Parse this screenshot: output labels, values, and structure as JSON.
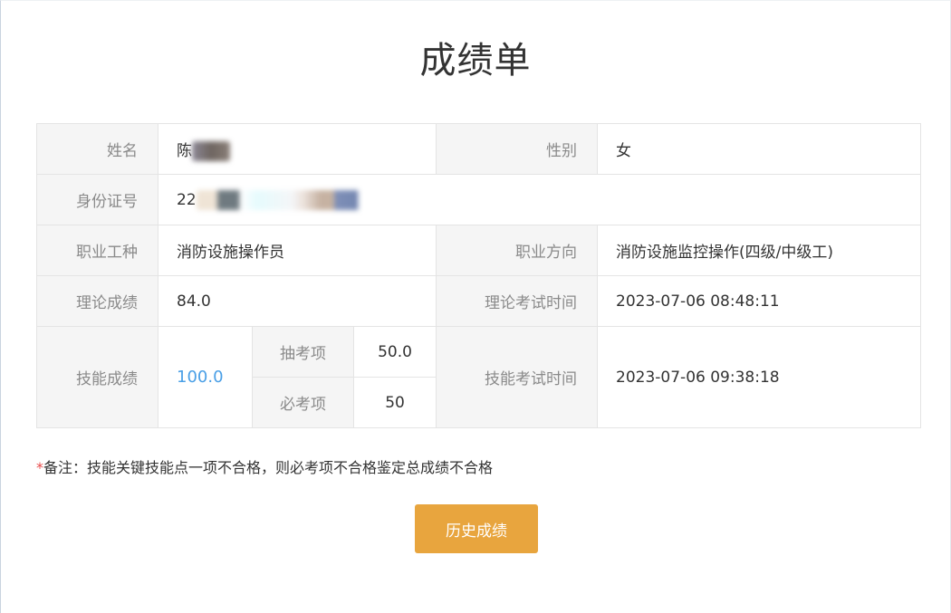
{
  "title": "成绩单",
  "rows": {
    "name_label": "姓名",
    "name_value": "陈",
    "gender_label": "性别",
    "gender_value": "女",
    "id_label": "身份证号",
    "id_value": "22",
    "occupation_label": "职业工种",
    "occupation_value": "消防设施操作员",
    "direction_label": "职业方向",
    "direction_value": "消防设施监控操作(四级/中级工)",
    "theory_label": "理论成绩",
    "theory_value": "84.0",
    "theory_time_label": "理论考试时间",
    "theory_time_value": "2023-07-06 08:48:11",
    "skill_label": "技能成绩",
    "skill_value": "100.0",
    "sample_label": "抽考项",
    "sample_value": "50.0",
    "required_label": "必考项",
    "required_value": "50",
    "skill_time_label": "技能考试时间",
    "skill_time_value": "2023-07-06 09:38:18"
  },
  "note": {
    "star": "*",
    "text": "备注：技能关键技能点一项不合格，则必考项不合格鉴定总成绩不合格"
  },
  "history_button_label": "历史成绩",
  "colors": {
    "accent_blue": "#4a9fe6",
    "button_orange": "#e8a53e",
    "required_star": "#e84a4a"
  }
}
